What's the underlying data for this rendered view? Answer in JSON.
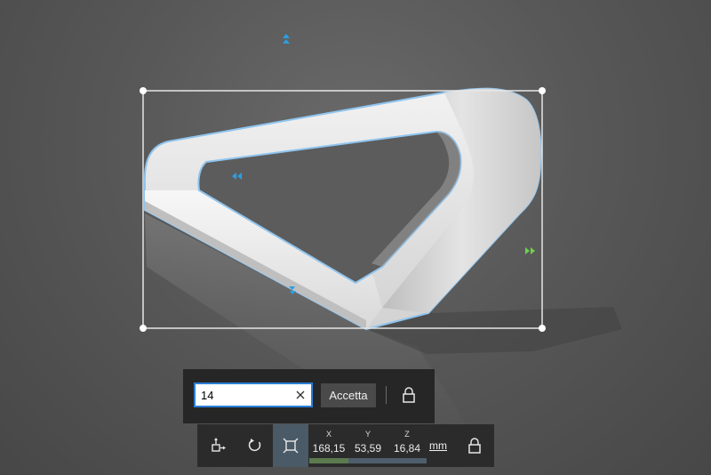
{
  "value_panel": {
    "input_value": "14",
    "accept_label": "Accetta"
  },
  "toolbar": {
    "coords": {
      "x_label": "X",
      "x_value": "168,15",
      "y_label": "Y",
      "y_value": "53,59",
      "z_label": "Z",
      "z_value": "16,84"
    },
    "unit": "mm"
  },
  "colors": {
    "accent_blue": "#2b9fe0",
    "accent_green": "#6fd14a",
    "selection_outline": "#8fc4ee",
    "input_border": "#2b7fd8"
  },
  "icons": {
    "top_handle": "double-chevron-up-icon",
    "left_handle": "double-chevron-left-icon",
    "right_handle": "double-chevron-right-icon",
    "bottom_handle": "double-chevron-icon",
    "clear": "close-icon",
    "lock": "lock-icon",
    "move": "move-icon",
    "rotate": "rotate-icon",
    "scale": "scale-icon"
  }
}
